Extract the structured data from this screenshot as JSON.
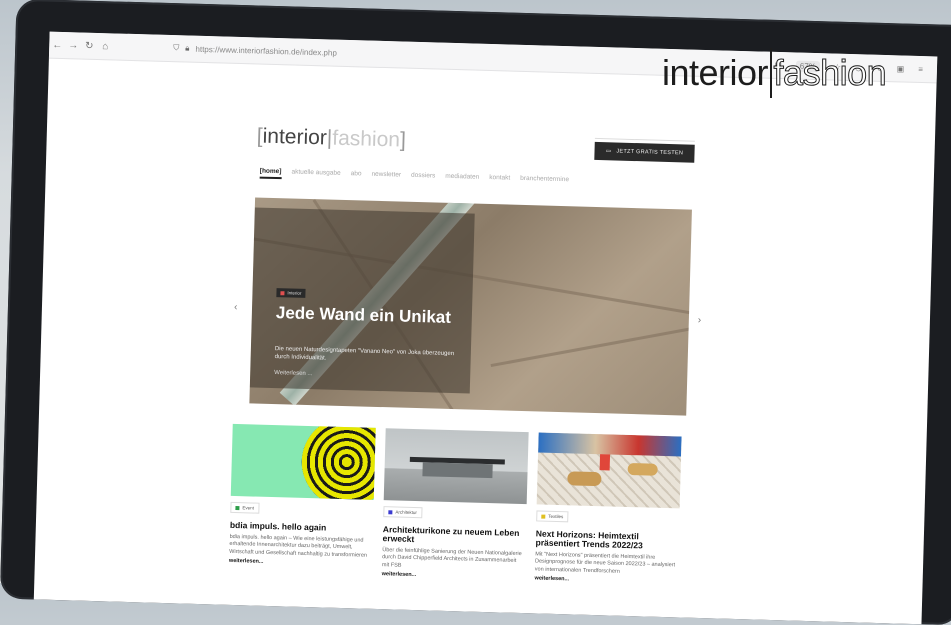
{
  "browser": {
    "url": "https://www.interiorfashion.de/index.php",
    "zoom": "67%"
  },
  "brand": {
    "part1": "interior",
    "part2": "fashion"
  },
  "site": {
    "logo_part1": "interior",
    "logo_part2": "fashion",
    "cta": "JETZT GRATIS TESTEN",
    "menu": [
      {
        "label": "[home]",
        "active": true
      },
      {
        "label": "aktuelle ausgabe"
      },
      {
        "label": "abo"
      },
      {
        "label": "newsletter"
      },
      {
        "label": "dossiers"
      },
      {
        "label": "mediadaten"
      },
      {
        "label": "kontakt"
      },
      {
        "label": "branchentermine"
      }
    ],
    "hero": {
      "tag": "Interior",
      "title": "Jede Wand ein Unikat",
      "text": "Die neuen Naturdesigntapeten \"Vanano Neo\" von Joka überzeugen durch Individualität.",
      "more": "Weiterlesen ..."
    },
    "cards": [
      {
        "tag": "Event",
        "tag_color": "#2e9e4a",
        "title": "bdia impuls. hello again",
        "text": "bdia impuls. hello again – Wie eine leistungsfähige und erhaltende Innenarchitektur dazu beiträgt, Umwelt, Wirtschaft und Gesellschaft nachhaltig zu transformieren",
        "more": "weiterlesen..."
      },
      {
        "tag": "Architektur",
        "tag_color": "#3b3bd0",
        "title": "Architekturikone zu neuem Leben erweckt",
        "text": "Über die feinfühlige Sanierung der Neuen Nationalgalerie durch David Chipperfield Architects in Zusammenarbeit mit FSB",
        "more": "weiterlesen..."
      },
      {
        "tag": "Textiles",
        "tag_color": "#e0c020",
        "title": "Next Horizons: Heimtextil präsentiert Trends 2022/23",
        "text": "Mit \"Next Horizons\" präsentiert die Heimtextil ihre Designprognose für die neue Saison 2022/23 – analysiert von internationalen Trendforschern",
        "more": "weiterlesen..."
      }
    ]
  }
}
